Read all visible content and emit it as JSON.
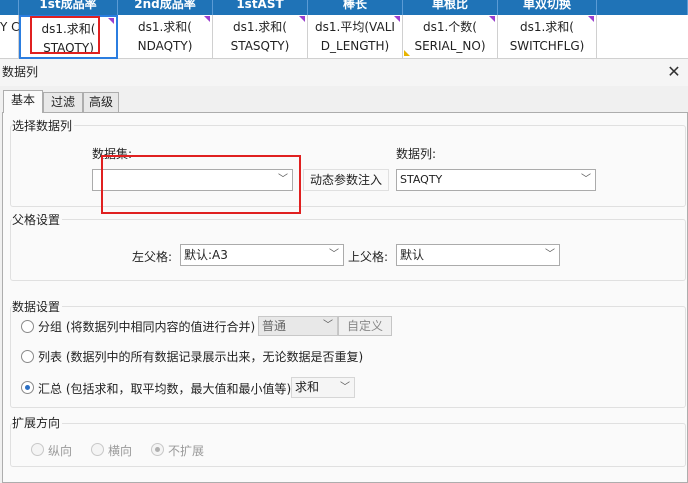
{
  "spreadsheet": {
    "headers": [
      "",
      "1st成品率",
      "2nd成品率",
      "1stAST",
      "棒长",
      "单根比",
      "单双切换"
    ],
    "rows": [
      {
        "line1": "Y C",
        "line2": ""
      },
      {
        "line1": "ds1.求和(",
        "line2": "STAQTY)"
      },
      {
        "line1": "ds1.求和(",
        "line2": "NDAQTY)"
      },
      {
        "line1": "ds1.求和(",
        "line2": "STASQTY)"
      },
      {
        "line1": "ds1.平均(VALI",
        "line2": "D_LENGTH)"
      },
      {
        "line1": "ds1.个数(",
        "line2": "SERIAL_NO)"
      },
      {
        "line1": "ds1.求和(",
        "line2": "SWITCHFLG)"
      }
    ]
  },
  "dialog": {
    "title": "数据列",
    "tabs": [
      "基本",
      "过滤",
      "高级"
    ],
    "select_column": {
      "legend": "选择数据列",
      "dataset_label": "数据集:",
      "dataset_value": "",
      "dynamic_param_button": "动态参数注入",
      "column_label": "数据列:",
      "column_value": "STAQTY"
    },
    "parent_settings": {
      "legend": "父格设置",
      "left_parent_label": "左父格:",
      "left_parent_value": "默认:A3",
      "top_parent_label": "上父格:",
      "top_parent_value": "默认"
    },
    "data_settings": {
      "legend": "数据设置",
      "group_label": "分组 (将数据列中相同内容的值进行合并)",
      "group_mode": "普通",
      "custom_button": "自定义",
      "list_label": "列表 (数据列中的所有数据记录展示出来，无论数据是否重复)",
      "summary_label": "汇总 (包括求和，取平均数，最大值和最小值等)",
      "summary_func": "求和"
    },
    "expand": {
      "legend": "扩展方向",
      "vertical": "纵向",
      "horizontal": "横向",
      "none": "不扩展"
    }
  },
  "colors": {
    "header_bg": "#1f73b7",
    "selection_outline": "#2b7de0",
    "highlight_box": "#e02020"
  }
}
